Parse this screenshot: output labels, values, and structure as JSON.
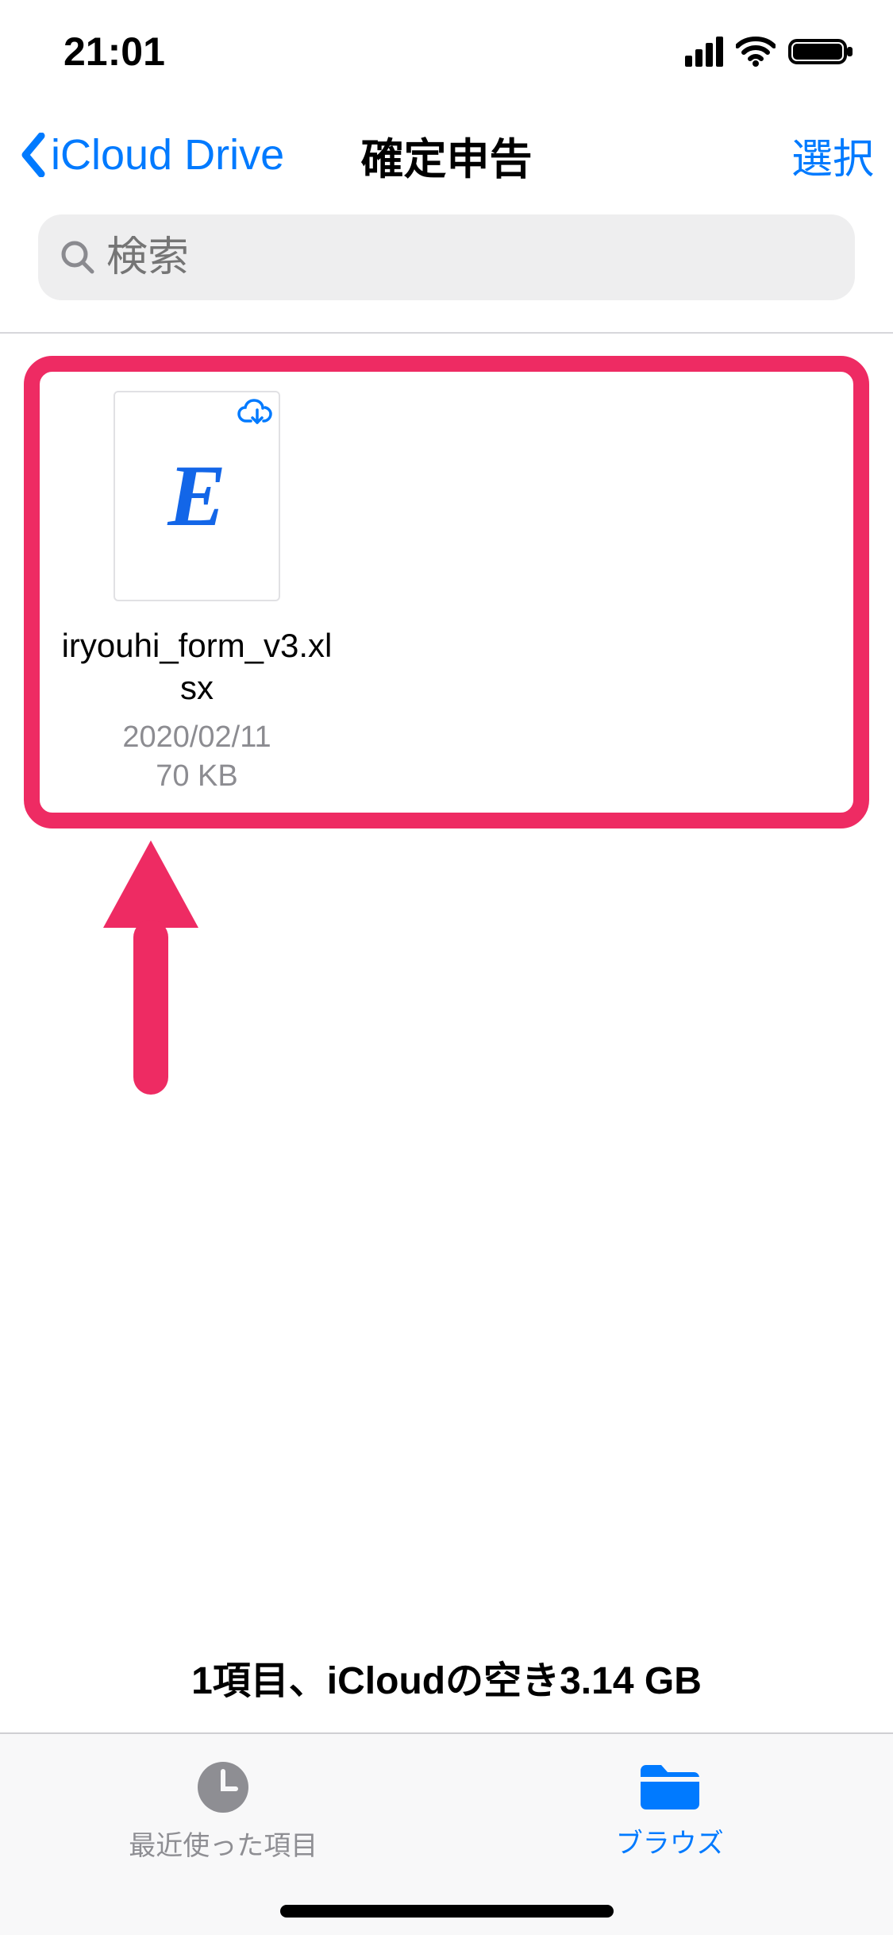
{
  "status": {
    "time": "21:01"
  },
  "nav": {
    "back_label": "iCloud Drive",
    "title": "確定申告",
    "select_label": "選択"
  },
  "search": {
    "placeholder": "検索"
  },
  "files": [
    {
      "name": "iryouhi_form_v3.xlsx",
      "date": "2020/02/11",
      "size": "70 KB",
      "icon_label": "E"
    }
  ],
  "footer_summary": "1項目、iCloudの空き3.14 GB",
  "tabs": {
    "recent_label": "最近使った項目",
    "browse_label": "ブラウズ"
  },
  "annotation": {
    "color": "#ee2b63"
  }
}
